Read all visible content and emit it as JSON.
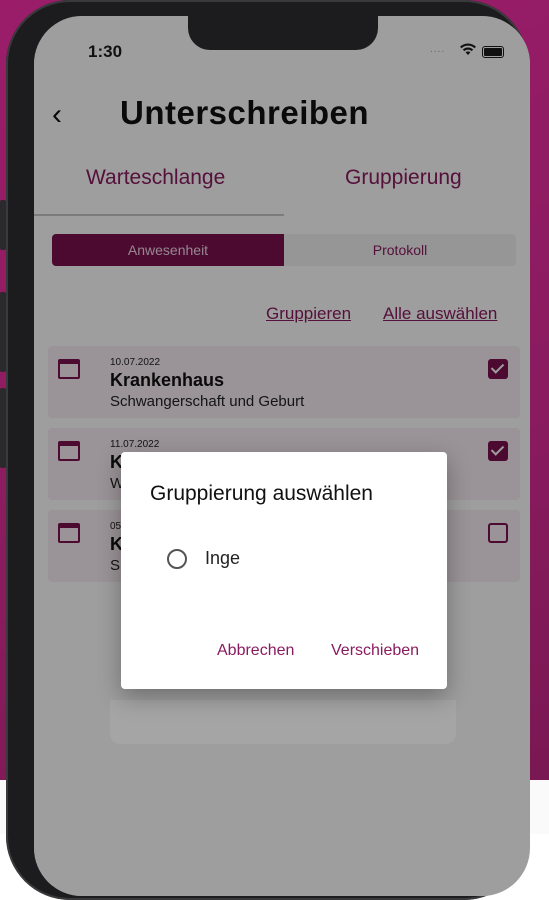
{
  "status_bar": {
    "time": "1:30",
    "signal": "....",
    "wifi_icon": "wifi-icon",
    "battery_icon": "battery-icon"
  },
  "header": {
    "back_icon": "chevron-left-icon",
    "title": "Unterschreiben"
  },
  "tabs": [
    {
      "label": "Warteschlange",
      "active": true
    },
    {
      "label": "Gruppierung",
      "active": false
    }
  ],
  "segments": [
    {
      "label": "Anwesenheit",
      "active": true
    },
    {
      "label": "Protokoll",
      "active": false
    }
  ],
  "actions": {
    "group_label": "Gruppieren",
    "select_all_label": "Alle auswählen"
  },
  "cards": [
    {
      "date": "10.07.2022",
      "title": "Krankenhaus",
      "subtitle": "Schwangerschaft und Geburt",
      "checked": true
    },
    {
      "date": "11.07.2022",
      "title": "K",
      "subtitle": "W",
      "checked": true
    },
    {
      "date": "05",
      "title": "K",
      "subtitle": "S",
      "checked": false
    }
  ],
  "dialog": {
    "title": "Gruppierung auswählen",
    "options": [
      {
        "label": "Inge",
        "selected": false
      }
    ],
    "cancel_label": "Abbrechen",
    "confirm_label": "Verschieben"
  },
  "colors": {
    "accent": "#8a1b5f",
    "accent_dark": "#7b1150",
    "card_bg": "#f9eef4",
    "background": "#9b1d6a"
  }
}
